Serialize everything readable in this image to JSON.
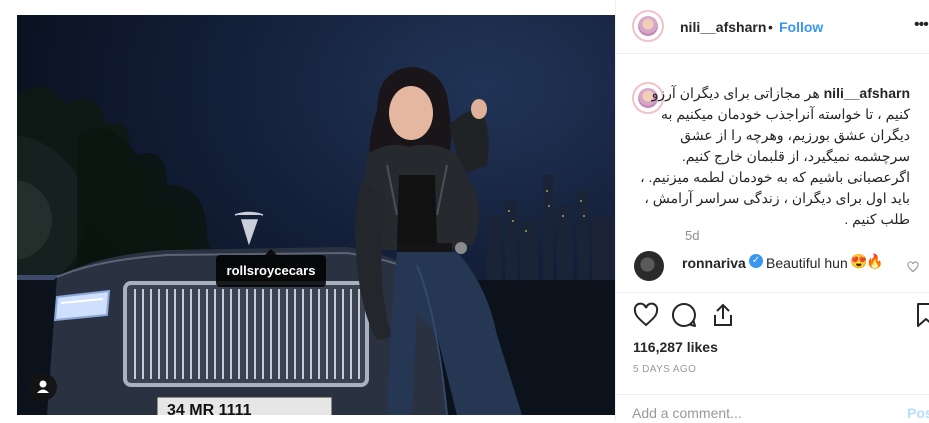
{
  "photo": {
    "tag_label": "rollsroycecars",
    "plate_text": "34 MR 1111",
    "tag_icon": "person-icon"
  },
  "header": {
    "username": "nili__afsharn",
    "separator": "•",
    "follow_label": "Follow",
    "more_label": "•••"
  },
  "caption": {
    "username": "nili__afsharn",
    "text": "هر مجازاتی برای دیگران آرزو کنیم ، تا خواسته آنراجذب خودمان میکنیم به دیگران عشق بورزیم، وهرچه را از عشق سرچشمه نمیگیرد، از قلبمان خارج کنیم. اگرعصبانی باشیم که به خودمان لطمه میزنیم. ، باید اول برای دیگران ، زندگی سراسر آرامش ، طلب کنیم .",
    "time_ago": "5d"
  },
  "comments": [
    {
      "username": "ronnariva",
      "text": "Beautiful hun",
      "emoji": [
        "😍",
        "🔥"
      ],
      "verified": true
    }
  ],
  "actions": {
    "like_icon": "heart-icon",
    "comment_icon": "comment-icon",
    "share_icon": "share-icon",
    "save_icon": "bookmark-icon"
  },
  "likes": {
    "count_text": "116,287 likes"
  },
  "date": "5 DAYS AGO",
  "add_comment": {
    "placeholder": "Add a comment...",
    "post_label": "Post"
  },
  "colors": {
    "accent": "#3897f0",
    "post_disabled": "#b2dffc",
    "border": "#efefef",
    "muted": "#8e8e8e"
  }
}
